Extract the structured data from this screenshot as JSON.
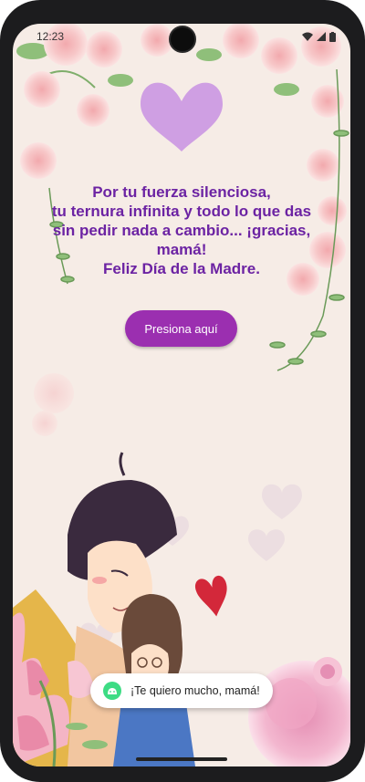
{
  "status_bar": {
    "time": "12:23",
    "icons": [
      "wifi-icon",
      "signal-icon",
      "battery-icon"
    ]
  },
  "message": {
    "lines": [
      "Por tu fuerza silenciosa,",
      "tu ternura infinita y todo lo que das",
      "sin pedir nada a cambio... ¡gracias,",
      "mamá!",
      "Feliz Día de la Madre."
    ],
    "color": "#6c23a3"
  },
  "button": {
    "label": "Presiona aquí",
    "color": "#9b2fb0"
  },
  "toast": {
    "icon": "android-icon",
    "text": "¡Te quiero mucho, mamá!"
  },
  "theme": {
    "background": "#f6ece6",
    "heart_color": "#cf9fe3"
  }
}
